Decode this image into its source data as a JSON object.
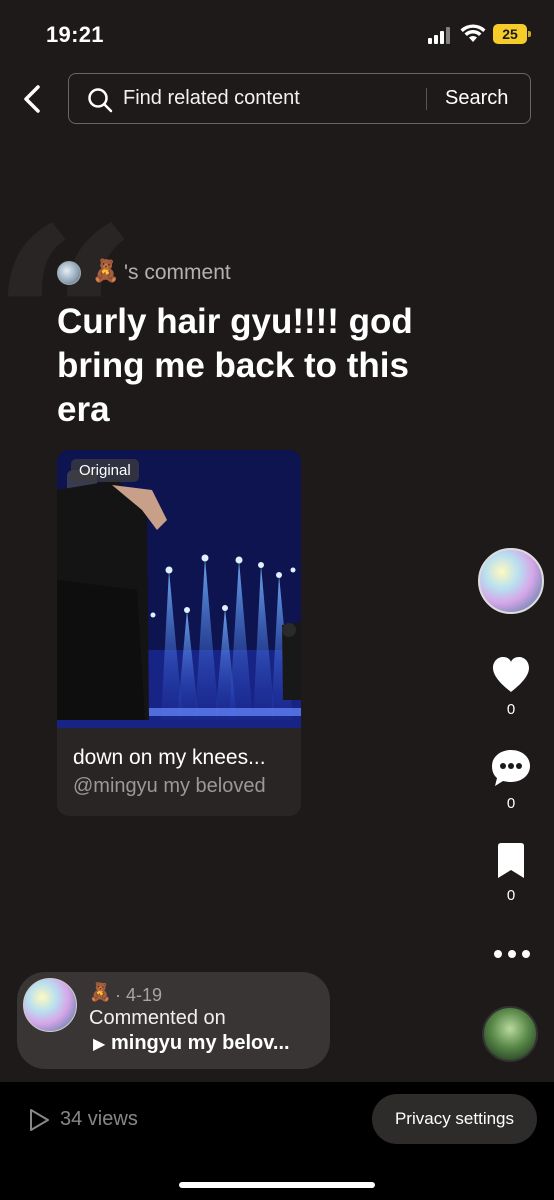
{
  "status_bar": {
    "time": "19:21",
    "battery": "25",
    "battery_color": "#f5cc2a"
  },
  "search": {
    "placeholder": "Find related content",
    "button": "Search"
  },
  "comment": {
    "emoji": "🧸",
    "label": "'s comment",
    "text": "Curly hair gyu!!!! god bring me back to this era"
  },
  "video": {
    "tag": "Original",
    "title": "down on my knees...",
    "author": "@mingyu my beloved"
  },
  "actions": {
    "likes": "0",
    "comments": "0",
    "saves": "0"
  },
  "comment_pill": {
    "emoji": "🧸",
    "date": "· 4-19",
    "line1": "Commented on",
    "play_icon": "▶",
    "line2": "mingyu my belov..."
  },
  "footer": {
    "views": "34 views",
    "privacy": "Privacy settings"
  },
  "colors": {
    "background": "#1e1a1a",
    "footer": "#000000",
    "accent_video": "#1a2d9a"
  }
}
